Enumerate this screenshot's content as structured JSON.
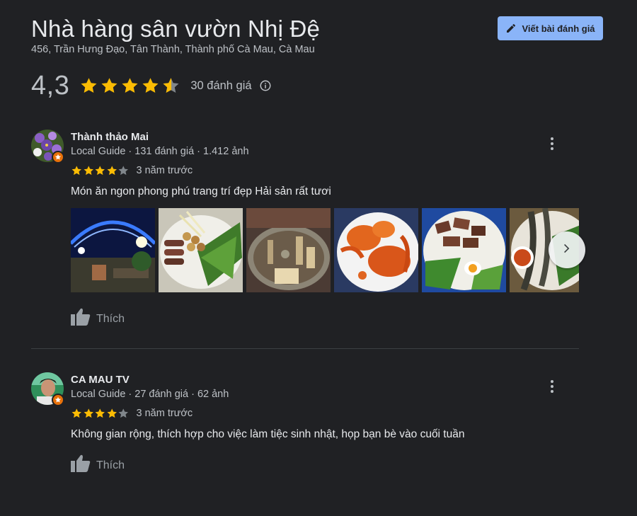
{
  "header": {
    "title": "Nhà hàng sân vườn Nhị Đệ",
    "address": "456, Trần Hưng Đạo, Tân Thành, Thành phố Cà Mau, Cà Mau",
    "write_review_label": "Viết bài đánh giá"
  },
  "summary": {
    "average": "4,3",
    "stars_value": 4.3,
    "count_label": "30 đánh giá"
  },
  "reviews": [
    {
      "name": "Thành thảo Mai",
      "meta": "Local Guide · 131 đánh giá · 1.412 ảnh",
      "stars": 4,
      "time": "3 năm trước",
      "text": "Món ăn ngon phong phú trang trí đẹp Hải sản rất tươi",
      "photos": [
        "photo-1",
        "photo-2",
        "photo-3",
        "photo-4",
        "photo-5",
        "photo-6"
      ],
      "like_label": "Thích"
    },
    {
      "name": "CA MAU TV",
      "meta": "Local Guide · 27 đánh giá · 62 ảnh",
      "stars": 4,
      "time": "3 năm trước",
      "text": "Không gian rộng, thích hợp cho việc làm tiệc sinh nhật, họp bạn bè vào cuối tuần",
      "like_label": "Thích"
    }
  ],
  "colors": {
    "background": "#202124",
    "accent_button": "#8ab4f8",
    "star": "#fbbc04",
    "star_empty": "#80868b",
    "guide_badge": "#e8710a"
  },
  "icons": [
    "pencil-icon",
    "star-icon",
    "info-icon",
    "more-vert-icon",
    "thumb-up-icon",
    "chevron-right-icon",
    "local-guide-icon"
  ]
}
